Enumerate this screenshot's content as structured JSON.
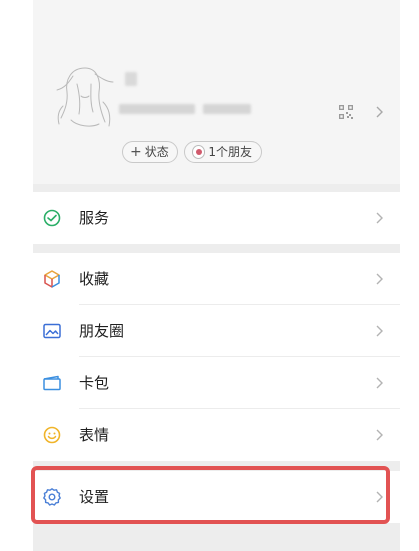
{
  "profile": {
    "chips": {
      "status_label": "状态",
      "friends_label": "1个朋友"
    }
  },
  "menu": {
    "services": "服务",
    "favorites": "收藏",
    "moments": "朋友圈",
    "cards": "卡包",
    "stickers": "表情",
    "settings": "设置"
  },
  "colors": {
    "highlight": "#e25353",
    "service_icon": "#2aae67",
    "favorites_icon_1": "#e8a33b",
    "favorites_icon_2": "#3b8fe0",
    "moments_icon": "#3b6fd6",
    "cards_icon": "#3b8fe0",
    "stickers_icon": "#f0b429",
    "settings_icon": "#4a7fd6"
  },
  "icons": {
    "qr": "qr-code-icon",
    "chevron": "chevron-right-icon"
  }
}
